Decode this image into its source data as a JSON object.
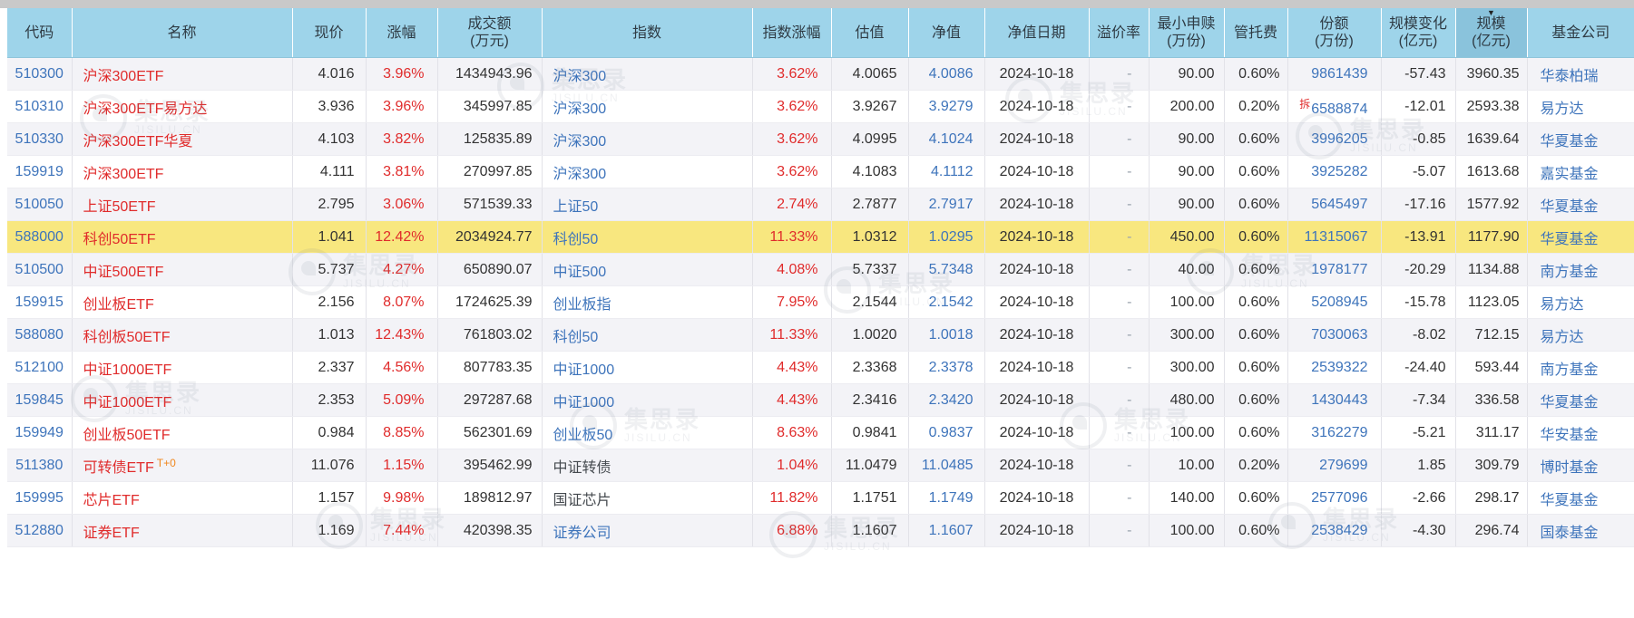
{
  "colors": {
    "header_bg": "#9ed4ea",
    "header_sorted_bg": "#8ac3dc",
    "row_bg": "#ffffff",
    "row_alt_bg": "#f3f3f7",
    "highlight_bg": "#f8e77f",
    "link_blue": "#3e74bb",
    "down_red": "#e02b2b",
    "text_dark": "#333333",
    "tag_orange": "#f0871e"
  },
  "watermark": {
    "name": "集思录",
    "domain": "JISILU.CN"
  },
  "table": {
    "sort_icon": "▼",
    "columns": [
      {
        "key": "code",
        "label": "代码",
        "sub": ""
      },
      {
        "key": "name",
        "label": "名称",
        "sub": ""
      },
      {
        "key": "price",
        "label": "现价",
        "sub": ""
      },
      {
        "key": "change",
        "label": "涨幅",
        "sub": ""
      },
      {
        "key": "turnover",
        "label": "成交额",
        "sub": "(万元)"
      },
      {
        "key": "index",
        "label": "指数",
        "sub": ""
      },
      {
        "key": "index_change",
        "label": "指数涨幅",
        "sub": ""
      },
      {
        "key": "valuation",
        "label": "估值",
        "sub": ""
      },
      {
        "key": "nav",
        "label": "净值",
        "sub": ""
      },
      {
        "key": "nav_date",
        "label": "净值日期",
        "sub": ""
      },
      {
        "key": "premium",
        "label": "溢价率",
        "sub": ""
      },
      {
        "key": "min_redeem",
        "label": "最小申赎",
        "sub": "(万份)"
      },
      {
        "key": "fee",
        "label": "管托费",
        "sub": ""
      },
      {
        "key": "shares",
        "label": "份额",
        "sub": "(万份)"
      },
      {
        "key": "scale_change",
        "label": "规模变化",
        "sub": "(亿元)"
      },
      {
        "key": "scale",
        "label": "规模",
        "sub": "(亿元)",
        "sorted": "desc"
      },
      {
        "key": "company",
        "label": "基金公司",
        "sub": ""
      }
    ],
    "rows": [
      {
        "code": "510300",
        "name": "沪深300ETF",
        "name_tag": "",
        "price": "4.016",
        "change": "3.96%",
        "turnover": "1434943.96",
        "index": "沪深300",
        "index_link": true,
        "index_change": "3.62%",
        "valuation": "4.0065",
        "nav": "4.0086",
        "nav_date": "2024-10-18",
        "premium": "-",
        "min_redeem": "90.00",
        "fee": "0.60%",
        "shares_prefix": "",
        "shares": "9861439",
        "scale_change": "-57.43",
        "scale": "3960.35",
        "company": "华泰柏瑞",
        "highlight": false
      },
      {
        "code": "510310",
        "name": "沪深300ETF易方达",
        "name_tag": "",
        "price": "3.936",
        "change": "3.96%",
        "turnover": "345997.85",
        "index": "沪深300",
        "index_link": true,
        "index_change": "3.62%",
        "valuation": "3.9267",
        "nav": "3.9279",
        "nav_date": "2024-10-18",
        "premium": "-",
        "min_redeem": "200.00",
        "fee": "0.20%",
        "shares_prefix": "拆",
        "shares": "6588874",
        "scale_change": "-12.01",
        "scale": "2593.38",
        "company": "易方达",
        "highlight": false
      },
      {
        "code": "510330",
        "name": "沪深300ETF华夏",
        "name_tag": "",
        "price": "4.103",
        "change": "3.82%",
        "turnover": "125835.89",
        "index": "沪深300",
        "index_link": true,
        "index_change": "3.62%",
        "valuation": "4.0995",
        "nav": "4.1024",
        "nav_date": "2024-10-18",
        "premium": "-",
        "min_redeem": "90.00",
        "fee": "0.60%",
        "shares_prefix": "",
        "shares": "3996205",
        "scale_change": "-0.85",
        "scale": "1639.64",
        "company": "华夏基金",
        "highlight": false
      },
      {
        "code": "159919",
        "name": "沪深300ETF",
        "name_tag": "",
        "price": "4.111",
        "change": "3.81%",
        "turnover": "270997.85",
        "index": "沪深300",
        "index_link": true,
        "index_change": "3.62%",
        "valuation": "4.1083",
        "nav": "4.1112",
        "nav_date": "2024-10-18",
        "premium": "-",
        "min_redeem": "90.00",
        "fee": "0.60%",
        "shares_prefix": "",
        "shares": "3925282",
        "scale_change": "-5.07",
        "scale": "1613.68",
        "company": "嘉实基金",
        "highlight": false
      },
      {
        "code": "510050",
        "name": "上证50ETF",
        "name_tag": "",
        "price": "2.795",
        "change": "3.06%",
        "turnover": "571539.33",
        "index": "上证50",
        "index_link": true,
        "index_change": "2.74%",
        "valuation": "2.7877",
        "nav": "2.7917",
        "nav_date": "2024-10-18",
        "premium": "-",
        "min_redeem": "90.00",
        "fee": "0.60%",
        "shares_prefix": "",
        "shares": "5645497",
        "scale_change": "-17.16",
        "scale": "1577.92",
        "company": "华夏基金",
        "highlight": false
      },
      {
        "code": "588000",
        "name": "科创50ETF",
        "name_tag": "",
        "price": "1.041",
        "change": "12.42%",
        "turnover": "2034924.77",
        "index": "科创50",
        "index_link": true,
        "index_change": "11.33%",
        "valuation": "1.0312",
        "nav": "1.0295",
        "nav_date": "2024-10-18",
        "premium": "-",
        "min_redeem": "450.00",
        "fee": "0.60%",
        "shares_prefix": "",
        "shares": "11315067",
        "scale_change": "-13.91",
        "scale": "1177.90",
        "company": "华夏基金",
        "highlight": true
      },
      {
        "code": "510500",
        "name": "中证500ETF",
        "name_tag": "",
        "price": "5.737",
        "change": "4.27%",
        "turnover": "650890.07",
        "index": "中证500",
        "index_link": true,
        "index_change": "4.08%",
        "valuation": "5.7337",
        "nav": "5.7348",
        "nav_date": "2024-10-18",
        "premium": "-",
        "min_redeem": "40.00",
        "fee": "0.60%",
        "shares_prefix": "",
        "shares": "1978177",
        "scale_change": "-20.29",
        "scale": "1134.88",
        "company": "南方基金",
        "highlight": false
      },
      {
        "code": "159915",
        "name": "创业板ETF",
        "name_tag": "",
        "price": "2.156",
        "change": "8.07%",
        "turnover": "1724625.39",
        "index": "创业板指",
        "index_link": true,
        "index_change": "7.95%",
        "valuation": "2.1544",
        "nav": "2.1542",
        "nav_date": "2024-10-18",
        "premium": "-",
        "min_redeem": "100.00",
        "fee": "0.60%",
        "shares_prefix": "",
        "shares": "5208945",
        "scale_change": "-15.78",
        "scale": "1123.05",
        "company": "易方达",
        "highlight": false
      },
      {
        "code": "588080",
        "name": "科创板50ETF",
        "name_tag": "",
        "price": "1.013",
        "change": "12.43%",
        "turnover": "761803.02",
        "index": "科创50",
        "index_link": true,
        "index_change": "11.33%",
        "valuation": "1.0020",
        "nav": "1.0018",
        "nav_date": "2024-10-18",
        "premium": "-",
        "min_redeem": "300.00",
        "fee": "0.60%",
        "shares_prefix": "",
        "shares": "7030063",
        "scale_change": "-8.02",
        "scale": "712.15",
        "company": "易方达",
        "highlight": false
      },
      {
        "code": "512100",
        "name": "中证1000ETF",
        "name_tag": "",
        "price": "2.337",
        "change": "4.56%",
        "turnover": "807783.35",
        "index": "中证1000",
        "index_link": true,
        "index_change": "4.43%",
        "valuation": "2.3368",
        "nav": "2.3378",
        "nav_date": "2024-10-18",
        "premium": "-",
        "min_redeem": "300.00",
        "fee": "0.60%",
        "shares_prefix": "",
        "shares": "2539322",
        "scale_change": "-24.40",
        "scale": "593.44",
        "company": "南方基金",
        "highlight": false
      },
      {
        "code": "159845",
        "name": "中证1000ETF",
        "name_tag": "",
        "price": "2.353",
        "change": "5.09%",
        "turnover": "297287.68",
        "index": "中证1000",
        "index_link": true,
        "index_change": "4.43%",
        "valuation": "2.3416",
        "nav": "2.3420",
        "nav_date": "2024-10-18",
        "premium": "-",
        "min_redeem": "480.00",
        "fee": "0.60%",
        "shares_prefix": "",
        "shares": "1430443",
        "scale_change": "-7.34",
        "scale": "336.58",
        "company": "华夏基金",
        "highlight": false
      },
      {
        "code": "159949",
        "name": "创业板50ETF",
        "name_tag": "",
        "price": "0.984",
        "change": "8.85%",
        "turnover": "562301.69",
        "index": "创业板50",
        "index_link": true,
        "index_change": "8.63%",
        "valuation": "0.9841",
        "nav": "0.9837",
        "nav_date": "2024-10-18",
        "premium": "-",
        "min_redeem": "100.00",
        "fee": "0.60%",
        "shares_prefix": "",
        "shares": "3162279",
        "scale_change": "-5.21",
        "scale": "311.17",
        "company": "华安基金",
        "highlight": false
      },
      {
        "code": "511380",
        "name": "可转债ETF",
        "name_tag": "T+0",
        "price": "11.076",
        "change": "1.15%",
        "turnover": "395462.99",
        "index": "中证转债",
        "index_link": false,
        "index_change": "1.04%",
        "valuation": "11.0479",
        "nav": "11.0485",
        "nav_date": "2024-10-18",
        "premium": "-",
        "min_redeem": "10.00",
        "fee": "0.20%",
        "shares_prefix": "",
        "shares": "279699",
        "scale_change": "1.85",
        "scale": "309.79",
        "company": "博时基金",
        "highlight": false
      },
      {
        "code": "159995",
        "name": "芯片ETF",
        "name_tag": "",
        "price": "1.157",
        "change": "9.98%",
        "turnover": "189812.97",
        "index": "国证芯片",
        "index_link": false,
        "index_change": "11.82%",
        "valuation": "1.1751",
        "nav": "1.1749",
        "nav_date": "2024-10-18",
        "premium": "-",
        "min_redeem": "140.00",
        "fee": "0.60%",
        "shares_prefix": "",
        "shares": "2577096",
        "scale_change": "-2.66",
        "scale": "298.17",
        "company": "华夏基金",
        "highlight": false
      },
      {
        "code": "512880",
        "name": "证券ETF",
        "name_tag": "",
        "price": "1.169",
        "change": "7.44%",
        "turnover": "420398.35",
        "index": "证券公司",
        "index_link": true,
        "index_change": "6.88%",
        "valuation": "1.1607",
        "nav": "1.1607",
        "nav_date": "2024-10-18",
        "premium": "-",
        "min_redeem": "100.00",
        "fee": "0.60%",
        "shares_prefix": "",
        "shares": "2538429",
        "scale_change": "-4.30",
        "scale": "296.74",
        "company": "国泰基金",
        "highlight": false
      }
    ]
  }
}
